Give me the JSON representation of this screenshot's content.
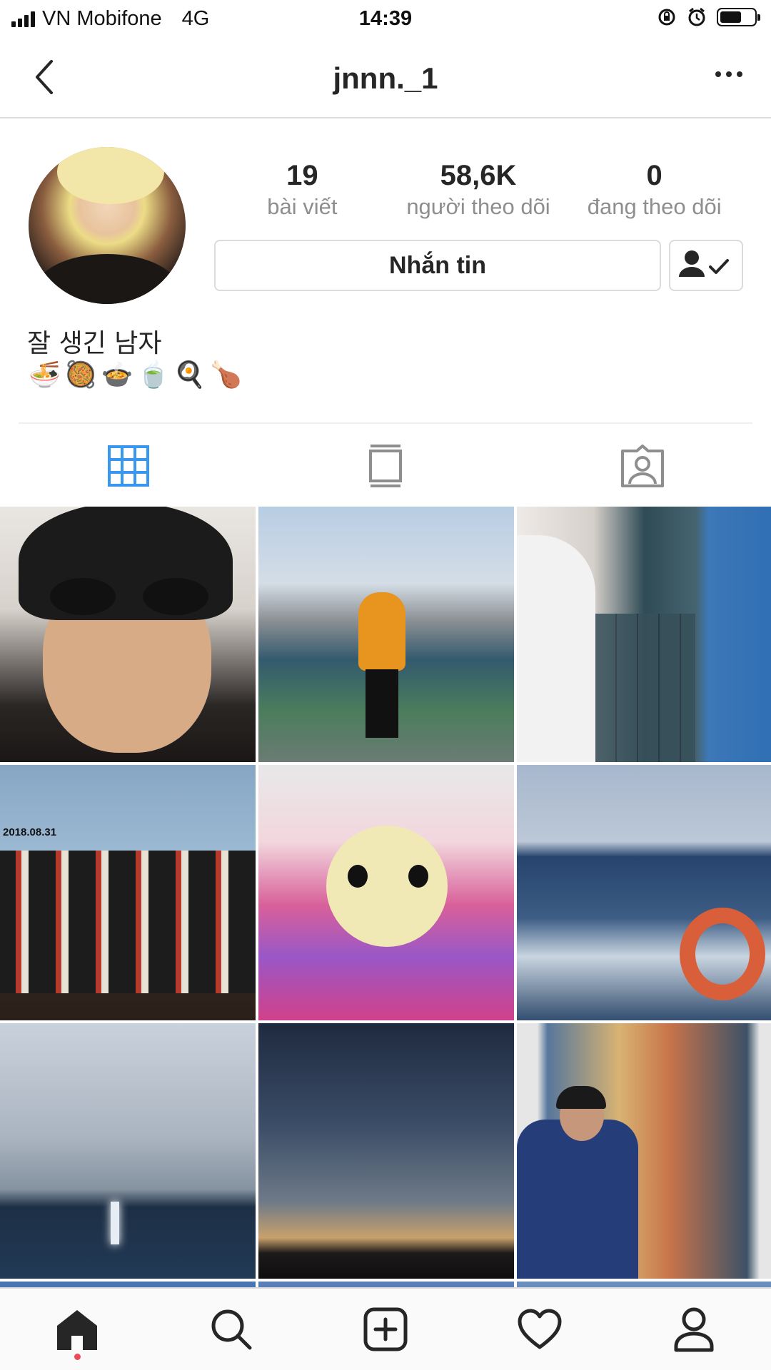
{
  "status_bar": {
    "carrier": "VN Mobifone",
    "network": "4G",
    "time": "14:39"
  },
  "header": {
    "username": "jnnn._1"
  },
  "profile": {
    "stats": [
      {
        "value": "19",
        "label": "bài viết"
      },
      {
        "value": "58,6K",
        "label": "người theo dõi"
      },
      {
        "value": "0",
        "label": "đang theo dõi"
      }
    ],
    "message_button": "Nhắn tin",
    "bio_name": "잘 생긴 남자",
    "bio_emojis": "🍜🥘🍲🍵🍳🍗"
  },
  "tabs": [
    {
      "icon": "grid-icon",
      "active": true
    },
    {
      "icon": "feed-icon",
      "active": false
    },
    {
      "icon": "tagged-icon",
      "active": false
    }
  ],
  "posts": [
    {
      "caption": "2018.08.31"
    }
  ],
  "colors": {
    "accent": "#3897f0",
    "notification_dot": "#ed4956",
    "border": "#dbdbdb",
    "secondary_text": "#8e8e8e"
  }
}
